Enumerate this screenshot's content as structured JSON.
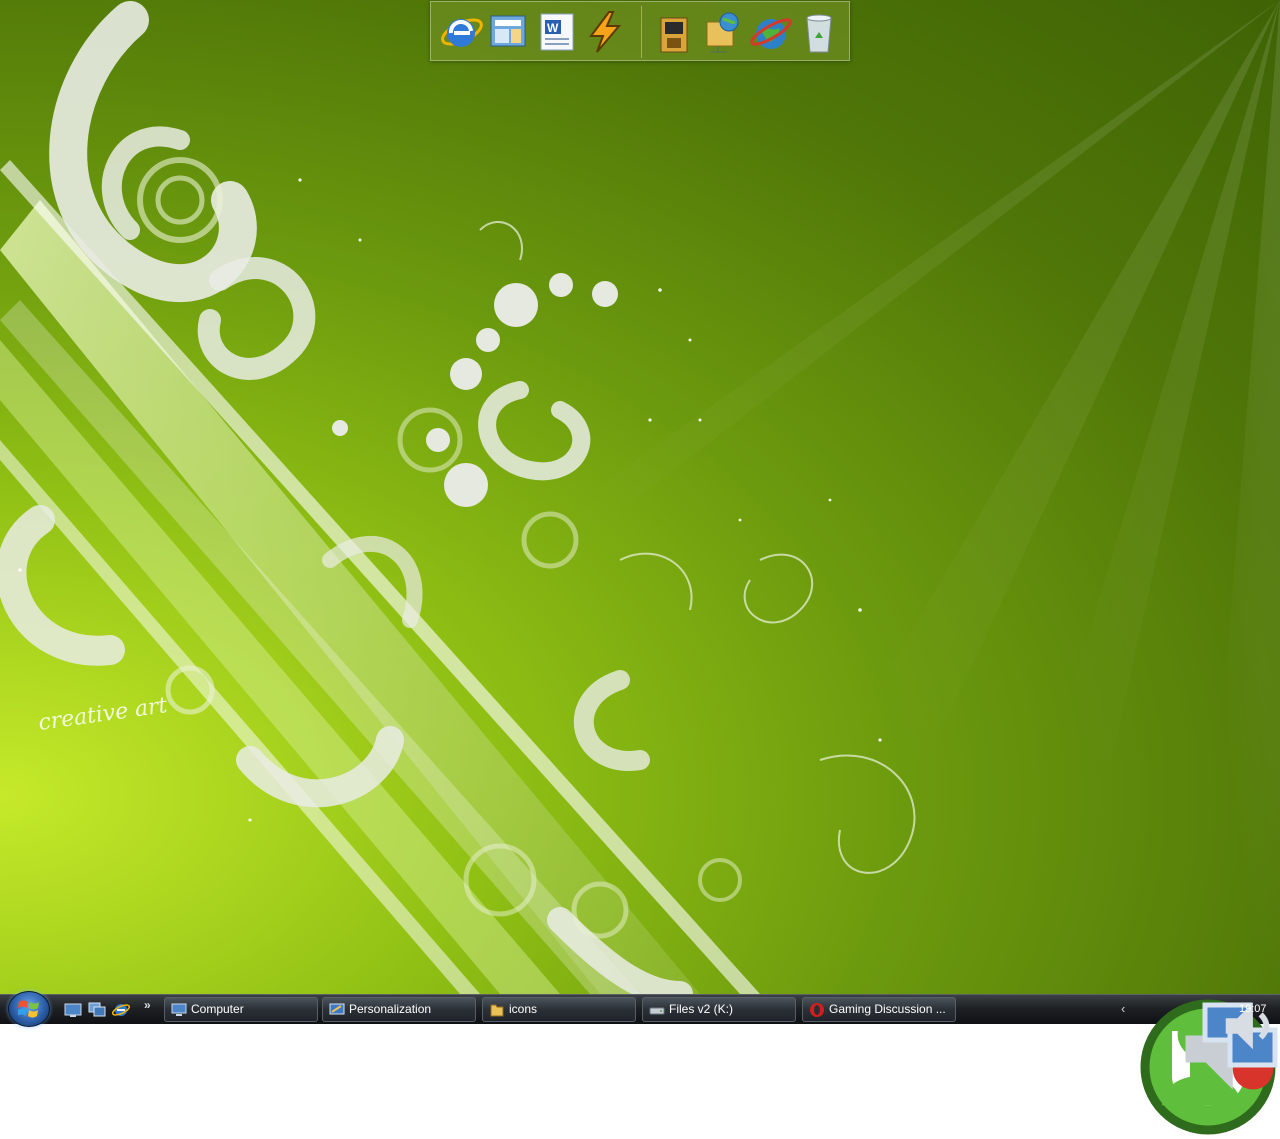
{
  "desktop": {
    "wallpaper_text": "creative art",
    "accent_color": "#7aa60f"
  },
  "dock": {
    "items": [
      {
        "name": "internet-explorer-icon"
      },
      {
        "name": "mail-icon"
      },
      {
        "name": "word-icon"
      },
      {
        "name": "winamp-icon"
      },
      {
        "name": "arcade-icon"
      },
      {
        "name": "network-folder-icon"
      },
      {
        "name": "internet-globe-icon"
      },
      {
        "name": "recycle-bin-icon"
      }
    ]
  },
  "taskbar": {
    "quick_launch": [
      {
        "name": "show-desktop-icon"
      },
      {
        "name": "switch-windows-icon"
      },
      {
        "name": "internet-explorer-icon"
      }
    ],
    "overflow_label": "»",
    "tasks": [
      {
        "label": "Computer",
        "icon": "computer-icon"
      },
      {
        "label": "Personalization",
        "icon": "personalization-icon"
      },
      {
        "label": "icons",
        "icon": "folder-icon"
      },
      {
        "label": "Files v2 (K:)",
        "icon": "drive-icon"
      },
      {
        "label": "Gaming Discussion ...",
        "icon": "opera-icon"
      }
    ],
    "tray": {
      "expand_label": "‹",
      "clock": "19:07"
    }
  }
}
